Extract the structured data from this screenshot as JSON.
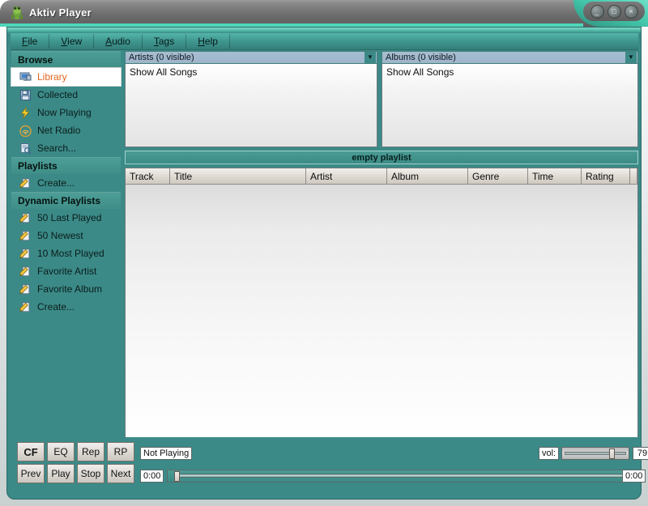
{
  "window": {
    "title": "Aktiv Player",
    "app_icon": "frog-icon",
    "controls": [
      {
        "name": "minimize",
        "glyph": "_"
      },
      {
        "name": "maximize",
        "glyph": "□"
      },
      {
        "name": "close",
        "glyph": "×"
      }
    ]
  },
  "menu": {
    "items": [
      {
        "label": "File",
        "accel": "F"
      },
      {
        "label": "View",
        "accel": "V"
      },
      {
        "label": "Audio",
        "accel": "A"
      },
      {
        "label": "Tags",
        "accel": "T"
      },
      {
        "label": "Help",
        "accel": "H"
      }
    ]
  },
  "sidebar": {
    "sections": [
      {
        "title": "Browse",
        "items": [
          {
            "label": "Library",
            "icon": "monitor-icon",
            "selected": true
          },
          {
            "label": "Collected",
            "icon": "floppy-disk-icon",
            "selected": false
          },
          {
            "label": "Now Playing",
            "icon": "lightning-bolt-icon",
            "selected": false
          },
          {
            "label": "Net Radio",
            "icon": "radio-waves-icon",
            "selected": false
          },
          {
            "label": "Search...",
            "icon": "document-search-icon",
            "selected": false
          }
        ]
      },
      {
        "title": "Playlists",
        "items": [
          {
            "label": "Create...",
            "icon": "pencil-document-icon",
            "selected": false
          }
        ]
      },
      {
        "title": "Dynamic Playlists",
        "items": [
          {
            "label": "50 Last Played",
            "icon": "dynamic-playlist-icon",
            "selected": false
          },
          {
            "label": "50 Newest",
            "icon": "dynamic-playlist-icon",
            "selected": false
          },
          {
            "label": "10 Most Played",
            "icon": "dynamic-playlist-icon",
            "selected": false
          },
          {
            "label": "Favorite Artist",
            "icon": "dynamic-playlist-icon",
            "selected": false
          },
          {
            "label": "Favorite Album",
            "icon": "dynamic-playlist-icon",
            "selected": false
          },
          {
            "label": "Create...",
            "icon": "dynamic-playlist-icon",
            "selected": false
          }
        ]
      }
    ]
  },
  "browser": {
    "artists": {
      "header": "Artists (0 visible)",
      "rows": [
        "Show All Songs"
      ]
    },
    "albums": {
      "header": "Albums (0 visible)",
      "rows": [
        "Show All Songs"
      ]
    }
  },
  "playlist": {
    "title": "empty playlist",
    "columns": [
      "Track",
      "Title",
      "Artist",
      "Album",
      "Genre",
      "Time",
      "Rating"
    ],
    "rows": []
  },
  "transport": {
    "row1": [
      "CF",
      "EQ",
      "Rep",
      "RP"
    ],
    "row2": [
      "Prev",
      "Play",
      "Stop",
      "Next"
    ],
    "status": "Not Playing",
    "elapsed": "0:00",
    "total": "0:00",
    "volume_label": "vol:",
    "volume_value": "79",
    "volume_percent": 79,
    "seek_percent": 0
  },
  "colors": {
    "teal_bg": "#3b8a87",
    "teal_light": "#4fb7a5",
    "accent_selected_text": "#e2661c",
    "titlebar_gray": "#6d6d6d",
    "panel_header_blue": "#a8bed2"
  }
}
